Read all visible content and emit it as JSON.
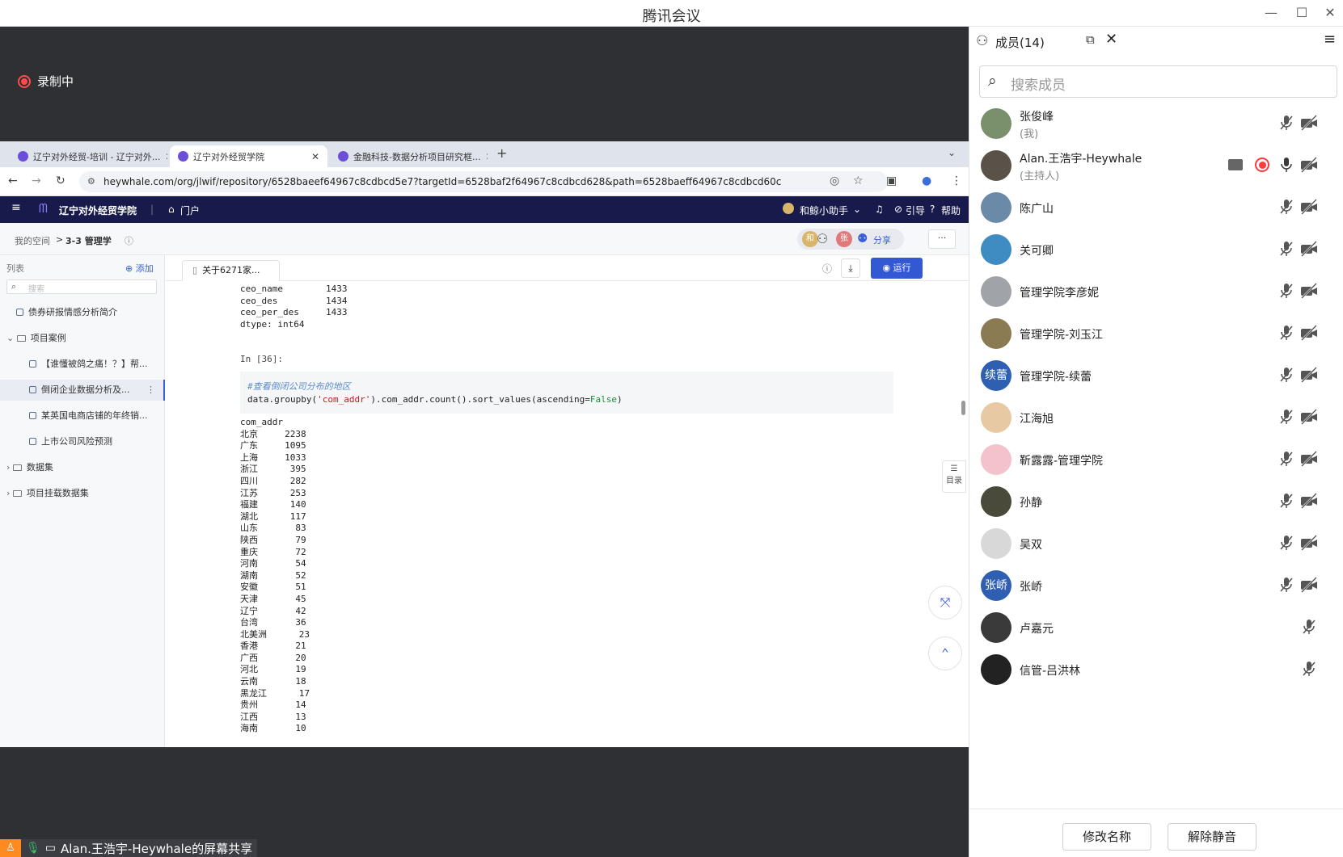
{
  "window": {
    "title": "腾讯会议"
  },
  "recording": {
    "label": "录制中"
  },
  "browser": {
    "tabs": [
      {
        "label": "辽宁对外经贸-培训 - 辽宁对外..."
      },
      {
        "label": "辽宁对外经贸学院"
      },
      {
        "label": "金融科技-数据分析项目研究框..."
      }
    ],
    "new_tab": "+",
    "url": "heywhale.com/org/jlwif/repository/6528baeef64967c8cdbcd5e7?targetId=6528baf2f64967c8cdbcd628&path=6528baeff64967c8cdbcd60c"
  },
  "site": {
    "org_name": "辽宁对外经贸学院",
    "portal": "门户",
    "assistant": "和鲸小助手",
    "guide": "引导",
    "help": "帮助",
    "breadcrumb_root": "我的空间",
    "breadcrumb_sep": ">",
    "breadcrumb_current": "3-3 管理学",
    "share": "分享",
    "avatar_labels": [
      "和",
      "张"
    ]
  },
  "sidebar": {
    "list_label": "列表",
    "add_label": "添加",
    "search_placeholder": "搜索",
    "items": [
      {
        "label": "债券研报情感分析简介",
        "kind": "file",
        "indent": 1
      },
      {
        "label": "项目案例",
        "kind": "folder-open",
        "indent": 0
      },
      {
        "label": "【谁懂被鸽之痛！？】帮...",
        "kind": "file",
        "indent": 2
      },
      {
        "label": "倒闭企业数据分析及...",
        "kind": "file",
        "indent": 2,
        "selected": true
      },
      {
        "label": "某英国电商店铺的年终销...",
        "kind": "file",
        "indent": 2
      },
      {
        "label": "上市公司风险预测",
        "kind": "file",
        "indent": 2
      },
      {
        "label": "数据集",
        "kind": "folder",
        "indent": 0
      },
      {
        "label": "项目挂载数据集",
        "kind": "folder",
        "indent": 0
      }
    ]
  },
  "notebook": {
    "tab_label": "关于6271家...",
    "run_label": "运行",
    "toc_label": "目录",
    "prev_output": "ceo_name        1433\nceo_des         1434\nceo_per_des     1433\ndtype: int64",
    "in_prompt": "In [36]:",
    "code_comment": "#查看倒闭公司分布的地区",
    "code_pre": "data.groupby(",
    "code_str": "'com_addr'",
    "code_mid": ").com_addr.count().sort_values(ascending=",
    "code_kw": "False",
    "code_post": ")",
    "output": "com_addr\n北京     2238\n广东     1095\n上海     1033\n浙江      395\n四川      282\n江苏      253\n福建      140\n湖北      117\n山东       83\n陕西       79\n重庆       72\n河南       54\n湖南       52\n安徽       51\n天津       45\n辽宁       42\n台湾       36\n北美洲      23\n香港       21\n广西       20\n河北       19\n云南       18\n黑龙江      17\n贵州       14\n江西       13\n海南       10"
  },
  "share_bar": {
    "label": "Alan.王浩宇-Heywhale的屏幕共享"
  },
  "panel": {
    "title": "成员(14)",
    "search_placeholder": "搜索成员",
    "members": [
      {
        "name": "张俊峰",
        "role": "(我)",
        "avatar_color": "#7a8f6b",
        "avatar_text": ""
      },
      {
        "name": "Alan.王浩宇-Heywhale",
        "role": "(主持人)",
        "avatar_color": "#5a5148",
        "avatar_text": ""
      },
      {
        "name": "陈广山",
        "role": "",
        "avatar_color": "#6a8aa8",
        "avatar_text": ""
      },
      {
        "name": "关可卿",
        "role": "",
        "avatar_color": "#3f8cc2",
        "avatar_text": ""
      },
      {
        "name": "管理学院李彦妮",
        "role": "",
        "avatar_color": "#a0a4a8",
        "avatar_text": ""
      },
      {
        "name": "管理学院-刘玉江",
        "role": "",
        "avatar_color": "#8a7b52",
        "avatar_text": ""
      },
      {
        "name": "管理学院-续蕾",
        "role": "",
        "avatar_color": "#2f5fb0",
        "avatar_text": "续蕾"
      },
      {
        "name": "江海旭",
        "role": "",
        "avatar_color": "#e7c9a4",
        "avatar_text": ""
      },
      {
        "name": "靳露露-管理学院",
        "role": "",
        "avatar_color": "#f3c2cc",
        "avatar_text": ""
      },
      {
        "name": "孙静",
        "role": "",
        "avatar_color": "#4a4a3a",
        "avatar_text": ""
      },
      {
        "name": "吴双",
        "role": "",
        "avatar_color": "#d8d8d8",
        "avatar_text": ""
      },
      {
        "name": "张峤",
        "role": "",
        "avatar_color": "#2f5fb0",
        "avatar_text": "张峤"
      },
      {
        "name": "卢嘉元",
        "role": "",
        "avatar_color": "#3a3a3a",
        "avatar_text": ""
      },
      {
        "name": "信管-吕洪林",
        "role": "",
        "avatar_color": "#222",
        "avatar_text": ""
      }
    ],
    "rename_label": "修改名称",
    "unmute_label": "解除静音",
    "colors": {
      "muted_mic": "#555",
      "active_mic": "#3a3a3a",
      "record": "#ff3b3b"
    }
  }
}
